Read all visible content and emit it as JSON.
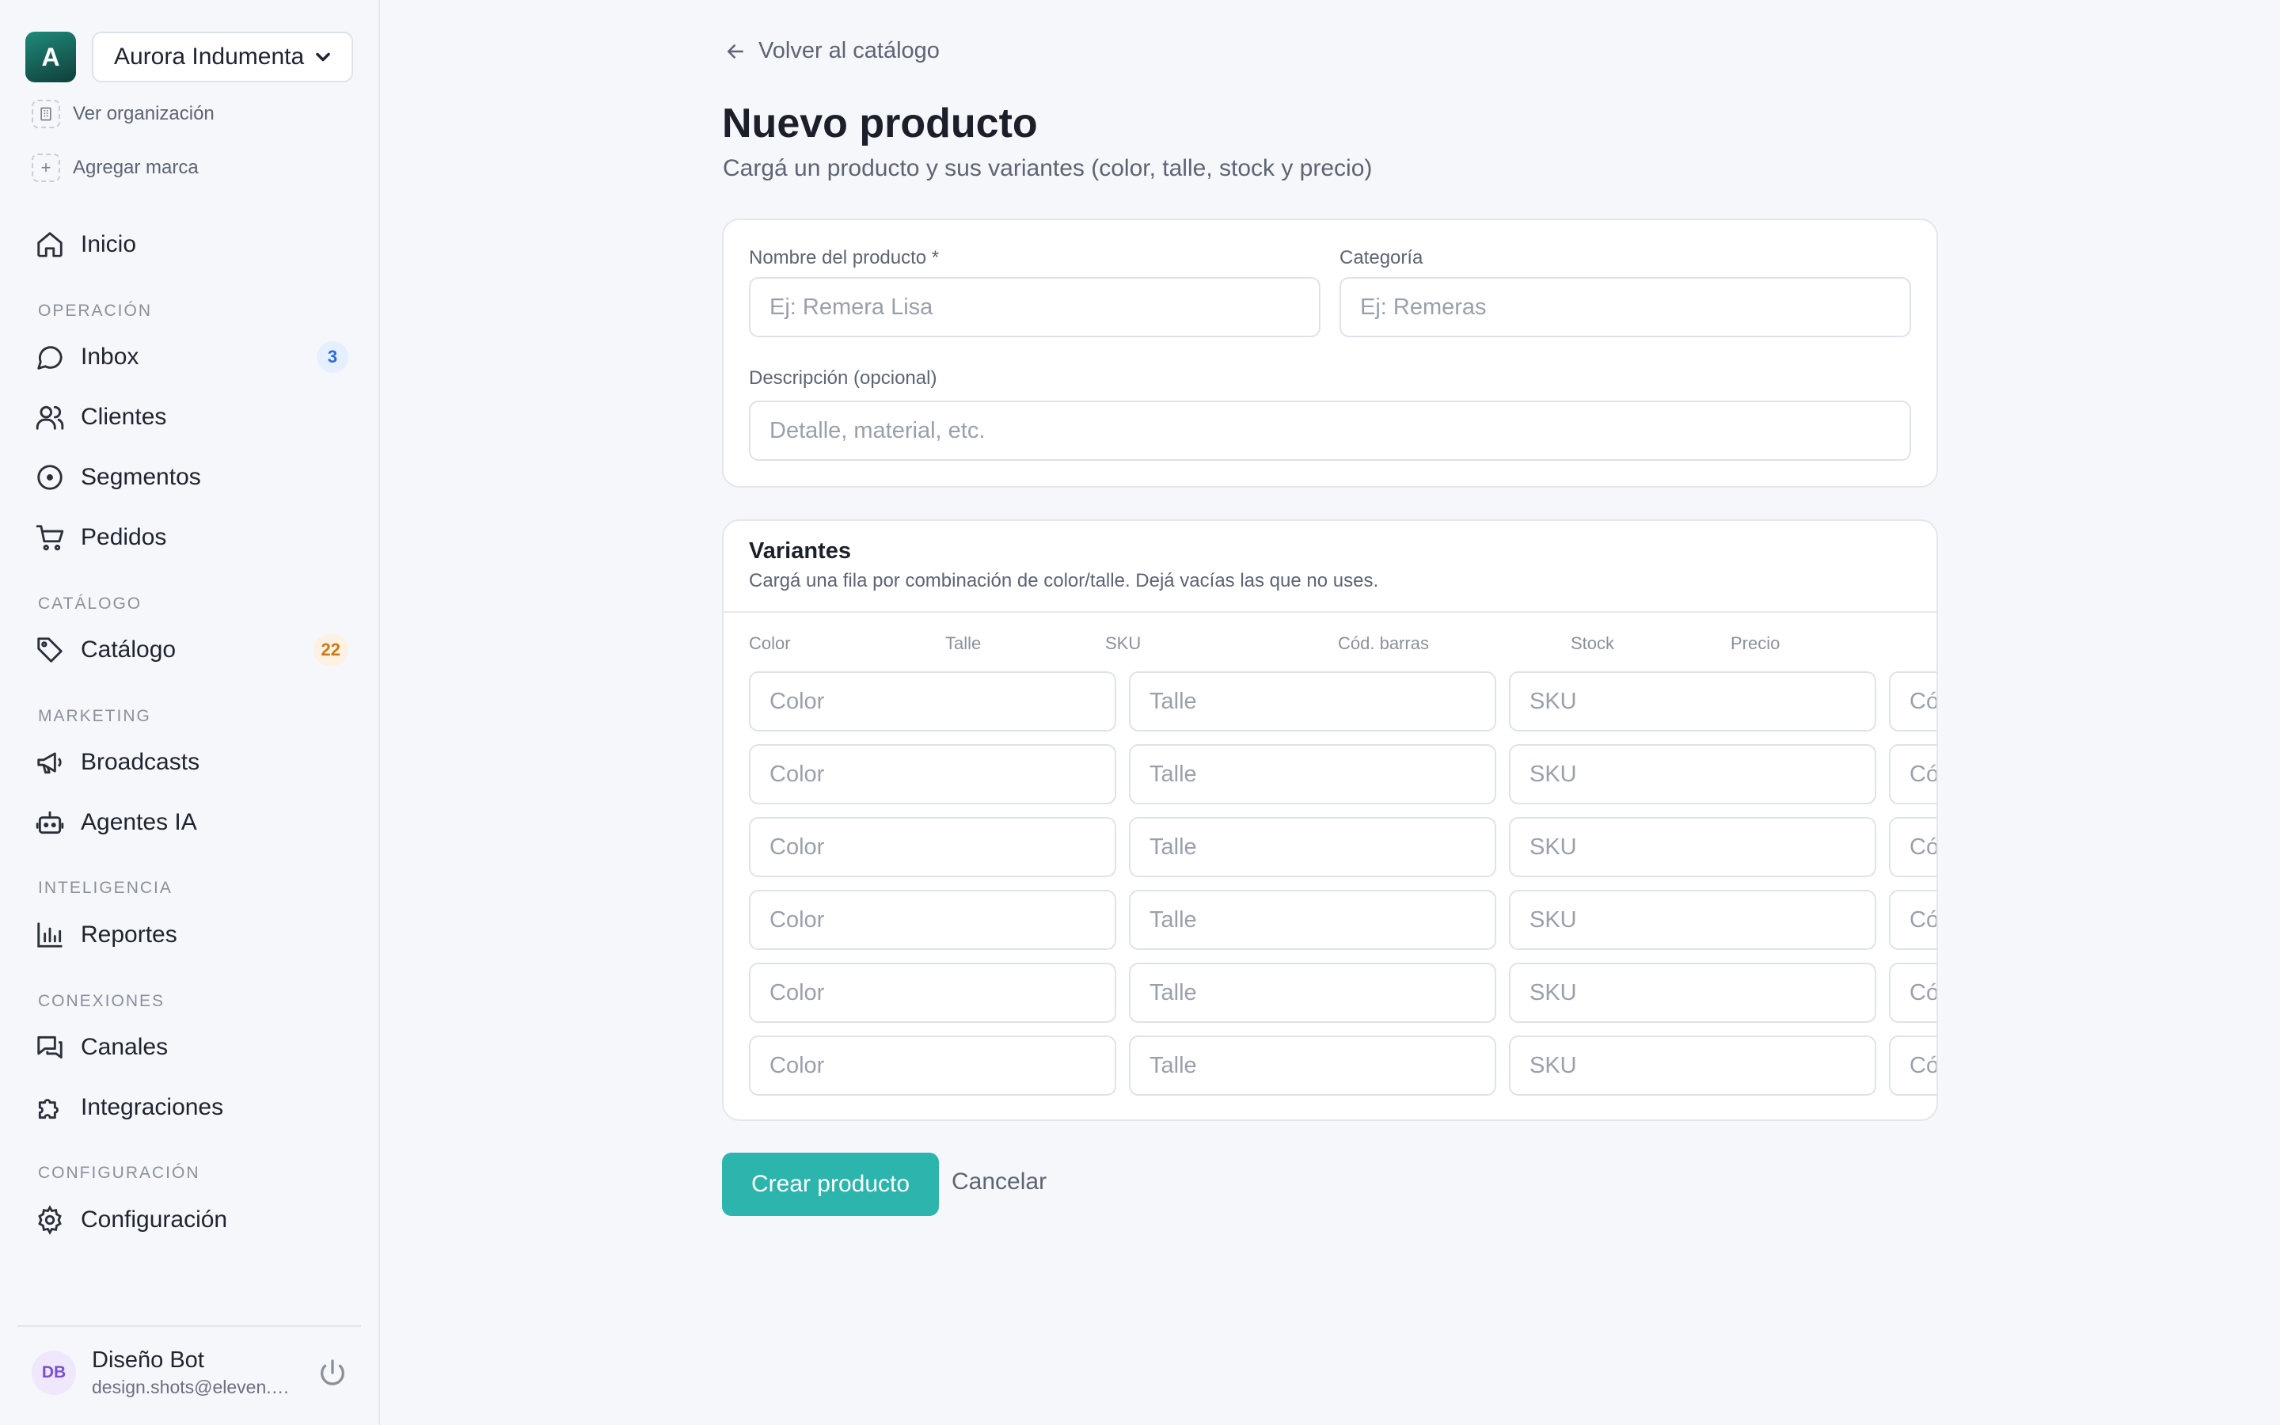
{
  "org": {
    "avatar_letter": "A",
    "name": "Aurora Indumentaria"
  },
  "org_links": {
    "view_org": "Ver organización",
    "add_brand": "Agregar marca"
  },
  "nav": {
    "home": "Inicio",
    "sections": {
      "operation": "OPERACIÓN",
      "catalog": "CATÁLOGO",
      "marketing": "MARKETING",
      "intelligence": "INTELIGENCIA",
      "connections": "CONEXIONES",
      "config": "CONFIGURACIÓN"
    },
    "items": {
      "inbox": {
        "label": "Inbox",
        "badge": "3"
      },
      "clients": {
        "label": "Clientes"
      },
      "segments": {
        "label": "Segmentos"
      },
      "orders": {
        "label": "Pedidos"
      },
      "catalog": {
        "label": "Catálogo",
        "badge": "22"
      },
      "broadcasts": {
        "label": "Broadcasts"
      },
      "agents": {
        "label": "Agentes IA"
      },
      "reports": {
        "label": "Reportes"
      },
      "channels": {
        "label": "Canales"
      },
      "integrations": {
        "label": "Integraciones"
      },
      "settings": {
        "label": "Configuración"
      }
    }
  },
  "user": {
    "initials": "DB",
    "name": "Diseño Bot",
    "email": "design.shots@eleven.app"
  },
  "page": {
    "back": "Volver al catálogo",
    "title": "Nuevo producto",
    "subtitle": "Cargá un producto y sus variantes (color, talle, stock y precio)"
  },
  "product_form": {
    "name_label": "Nombre del producto *",
    "name_placeholder": "Ej: Remera Lisa",
    "category_label": "Categoría",
    "category_placeholder": "Ej: Remeras",
    "description_label": "Descripción (opcional)",
    "description_placeholder": "Detalle, material, etc."
  },
  "variants": {
    "title": "Variantes",
    "subtitle": "Cargá una fila por combinación de color/talle. Dejá vacías las que no uses.",
    "columns": [
      "Color",
      "Talle",
      "SKU",
      "Cód. barras",
      "Stock",
      "Precio"
    ],
    "placeholders": {
      "color": "Color",
      "size": "Talle",
      "sku": "SKU",
      "barcode": "Cód. barras"
    },
    "row_count": 6
  },
  "actions": {
    "create": "Crear producto",
    "cancel": "Cancelar"
  },
  "colors": {
    "accent": "#2bb5ad",
    "background": "#f6f7fb"
  }
}
